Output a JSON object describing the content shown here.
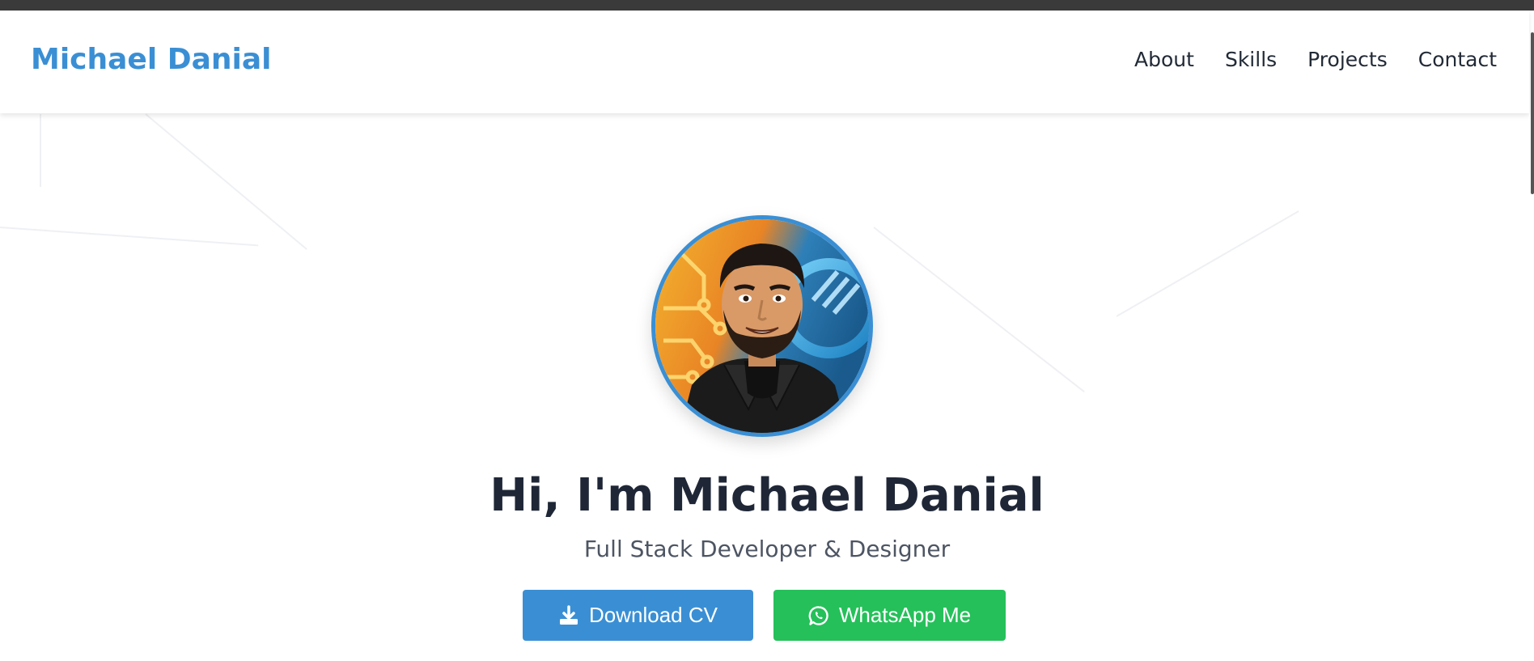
{
  "nav": {
    "brand": "Michael Danial",
    "links": [
      {
        "label": "About"
      },
      {
        "label": "Skills"
      },
      {
        "label": "Projects"
      },
      {
        "label": "Contact"
      }
    ]
  },
  "hero": {
    "headline": "Hi, I'm Michael Danial",
    "subtitle": "Full Stack Developer & Designer",
    "buttons": {
      "download_cv": {
        "label": "Download CV",
        "icon": "download-icon"
      },
      "whatsapp": {
        "label": "WhatsApp Me",
        "icon": "whatsapp-icon"
      }
    }
  },
  "colors": {
    "accent": "#3a8fd4",
    "whatsapp": "#25c05a",
    "heading": "#1f2737",
    "text": "#4d5563"
  }
}
